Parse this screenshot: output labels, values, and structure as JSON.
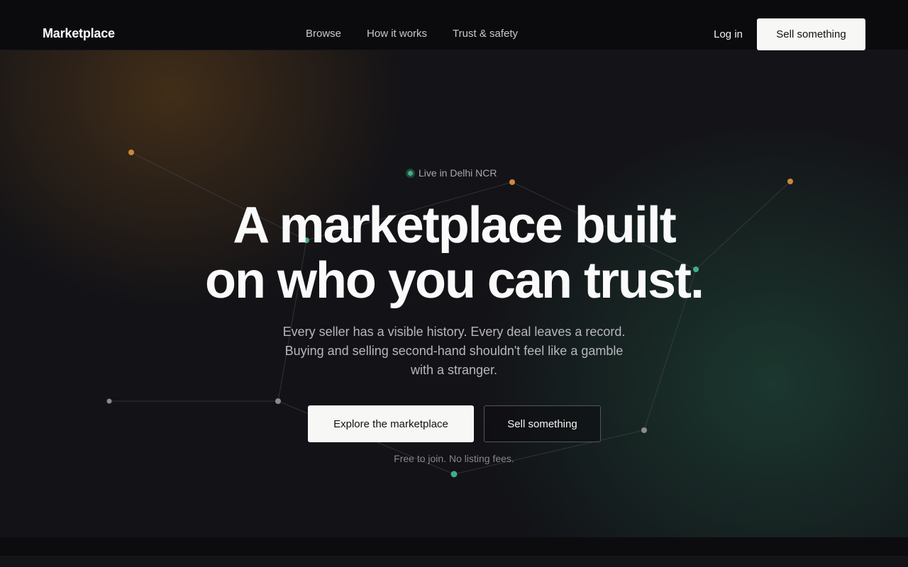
{
  "brand": {
    "name": "Marketplace"
  },
  "nav": {
    "links": [
      "Browse",
      "How it works",
      "Trust & safety"
    ],
    "login_label": "Log in",
    "sell_label": "Sell something"
  },
  "hero": {
    "badge": "Live in Delhi NCR",
    "headline_line1": "A marketplace built",
    "headline_line2": "on who you can trust.",
    "subtext": "Every seller has a visible history. Every deal leaves a record. Buying and selling second-hand shouldn't feel like a gamble with a stranger.",
    "primary_cta": "Explore the marketplace",
    "secondary_cta": "Sell something",
    "footnote": "Free to join. No listing fees."
  },
  "colors": {
    "accent_amber": "#c98a3a",
    "accent_green": "#3fae85",
    "node_gray": "#8a8a90",
    "background": "#121217"
  }
}
